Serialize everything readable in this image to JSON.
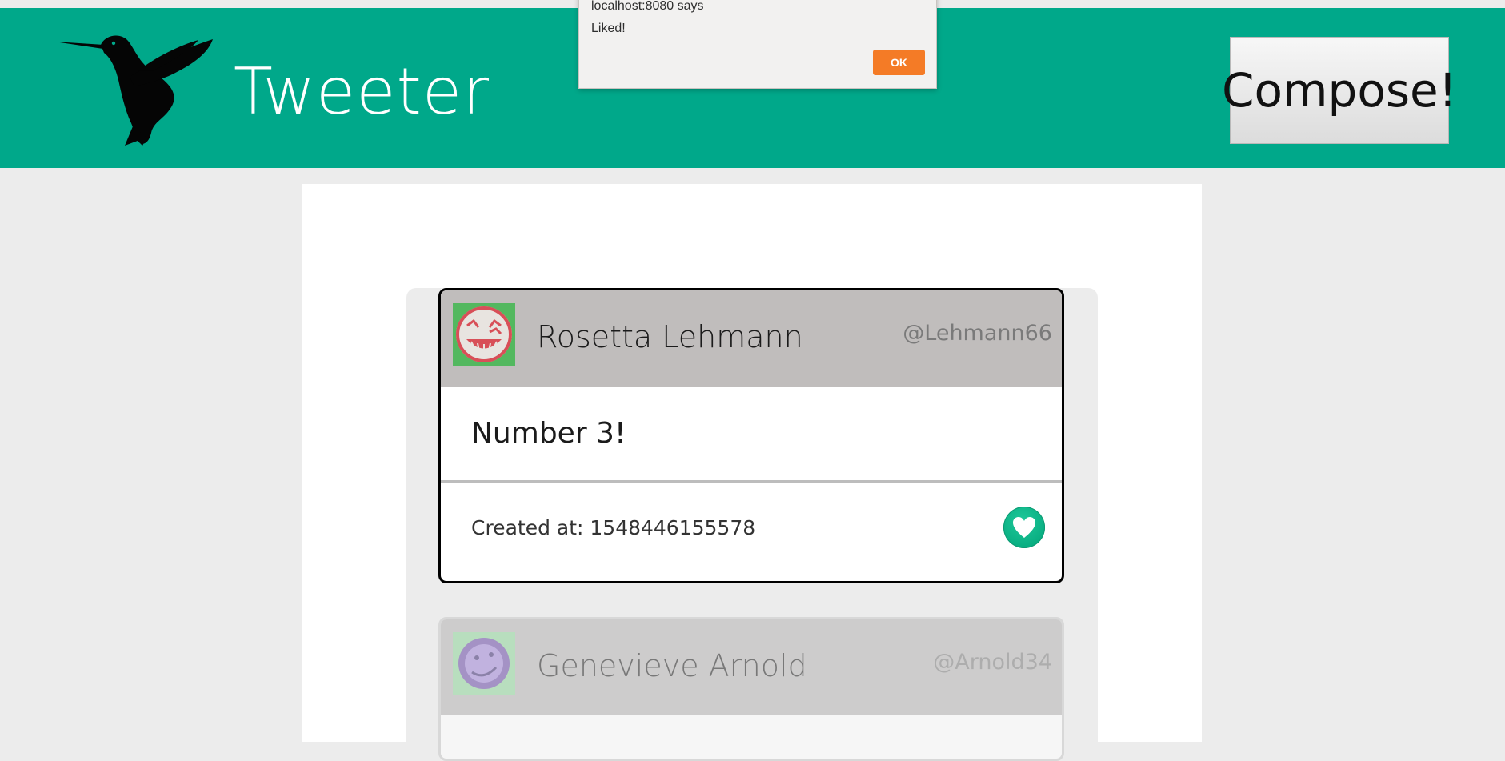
{
  "header": {
    "brand": "Tweeter",
    "compose_label": "Compose!",
    "icon": "hummingbird-logo"
  },
  "dialog": {
    "title": "localhost:8080 says",
    "message": "Liked!",
    "ok_label": "OK"
  },
  "tweets": [
    {
      "name": "Rosetta Lehmann",
      "handle": "@Lehmann66",
      "text": "Number 3!",
      "created": "Created at: 1548446155578",
      "avatar_icon": "grinning-face-avatar",
      "like_icon": "heart-icon"
    },
    {
      "name": "Genevieve Arnold",
      "handle": "@Arnold34",
      "avatar_icon": "purple-face-avatar"
    }
  ],
  "colors": {
    "header": "#00a88a",
    "page_background": "#ececec",
    "card_header": "#c0bdbc",
    "like_button": "#00a478",
    "dialog_ok": "#f47b26"
  }
}
